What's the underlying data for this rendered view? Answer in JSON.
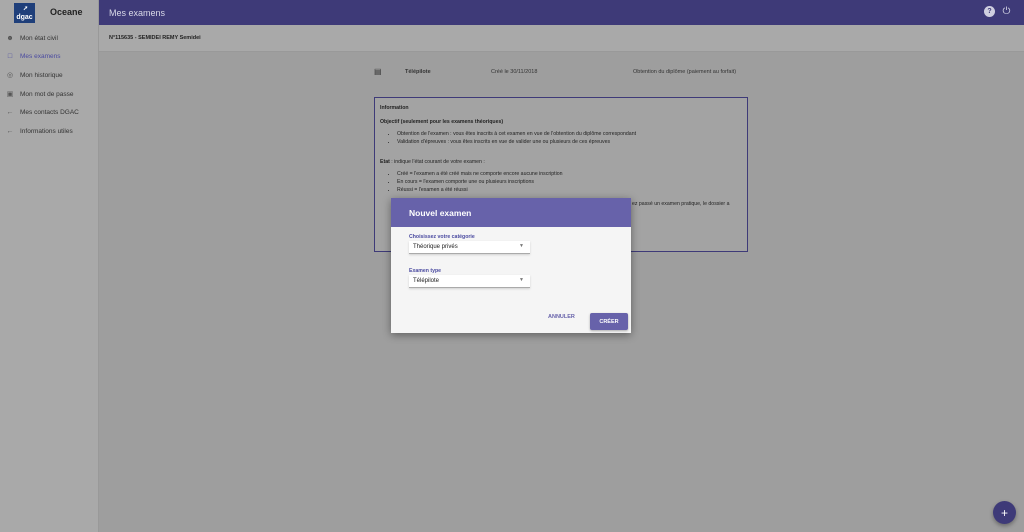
{
  "brand": {
    "logo_text": "dgac",
    "app_name": "Oceane"
  },
  "sidebar": {
    "items": [
      {
        "label": "Mon état civil",
        "icon": "person-icon"
      },
      {
        "label": "Mes examens",
        "icon": "folder-icon",
        "active": true
      },
      {
        "label": "Mon historique",
        "icon": "globe-icon"
      },
      {
        "label": "Mon mot de passe",
        "icon": "lock-icon"
      },
      {
        "label": "Mes contacts DGAC",
        "icon": "arrow-left-icon"
      },
      {
        "label": "Informations utiles",
        "icon": "arrow-left-icon"
      }
    ]
  },
  "header": {
    "title": "Mes examens"
  },
  "user": {
    "id_line": "N°115635 - SEMIDEI REMY Semidei"
  },
  "exam": {
    "name": "Télépilote",
    "created": "Créé le 30/11/2018",
    "status": "Obtention du diplôme (paiement au forfait)"
  },
  "info": {
    "title": "Information",
    "objective_heading": "Objectif (seulement pour les examens théoriques)",
    "objective_items": [
      "Obtention de l'examen : vous êtes inscrits à cet examen en vue de l'obtention du diplôme correspondant",
      "Validation d'épreuves : vous êtes inscrits en vue de valider une ou plusieurs de ces épreuves"
    ],
    "state_heading": "Etat",
    "state_intro": " : indique l'état courant de votre examen :",
    "state_items": [
      "Créé = l'examen a été créé mais ne comporte encore aucune inscription",
      "En cours = l'examen comporte une ou plusieurs inscriptions",
      "Réussi = l'examen a été réussi"
    ],
    "partial_text": "ez passé un examen pratique, le dossier a"
  },
  "modal": {
    "title": "Nouvel examen",
    "category_label": "Choisissez votre catégorie",
    "category_value": "Théorique privés",
    "type_label": "Examen type",
    "type_value": "Télépilote",
    "cancel_label": "ANNULER",
    "create_label": "CRÉER"
  },
  "fab": {
    "label": "+"
  },
  "colors": {
    "primary": "#3e3a78",
    "modal_accent": "#6762aa"
  }
}
